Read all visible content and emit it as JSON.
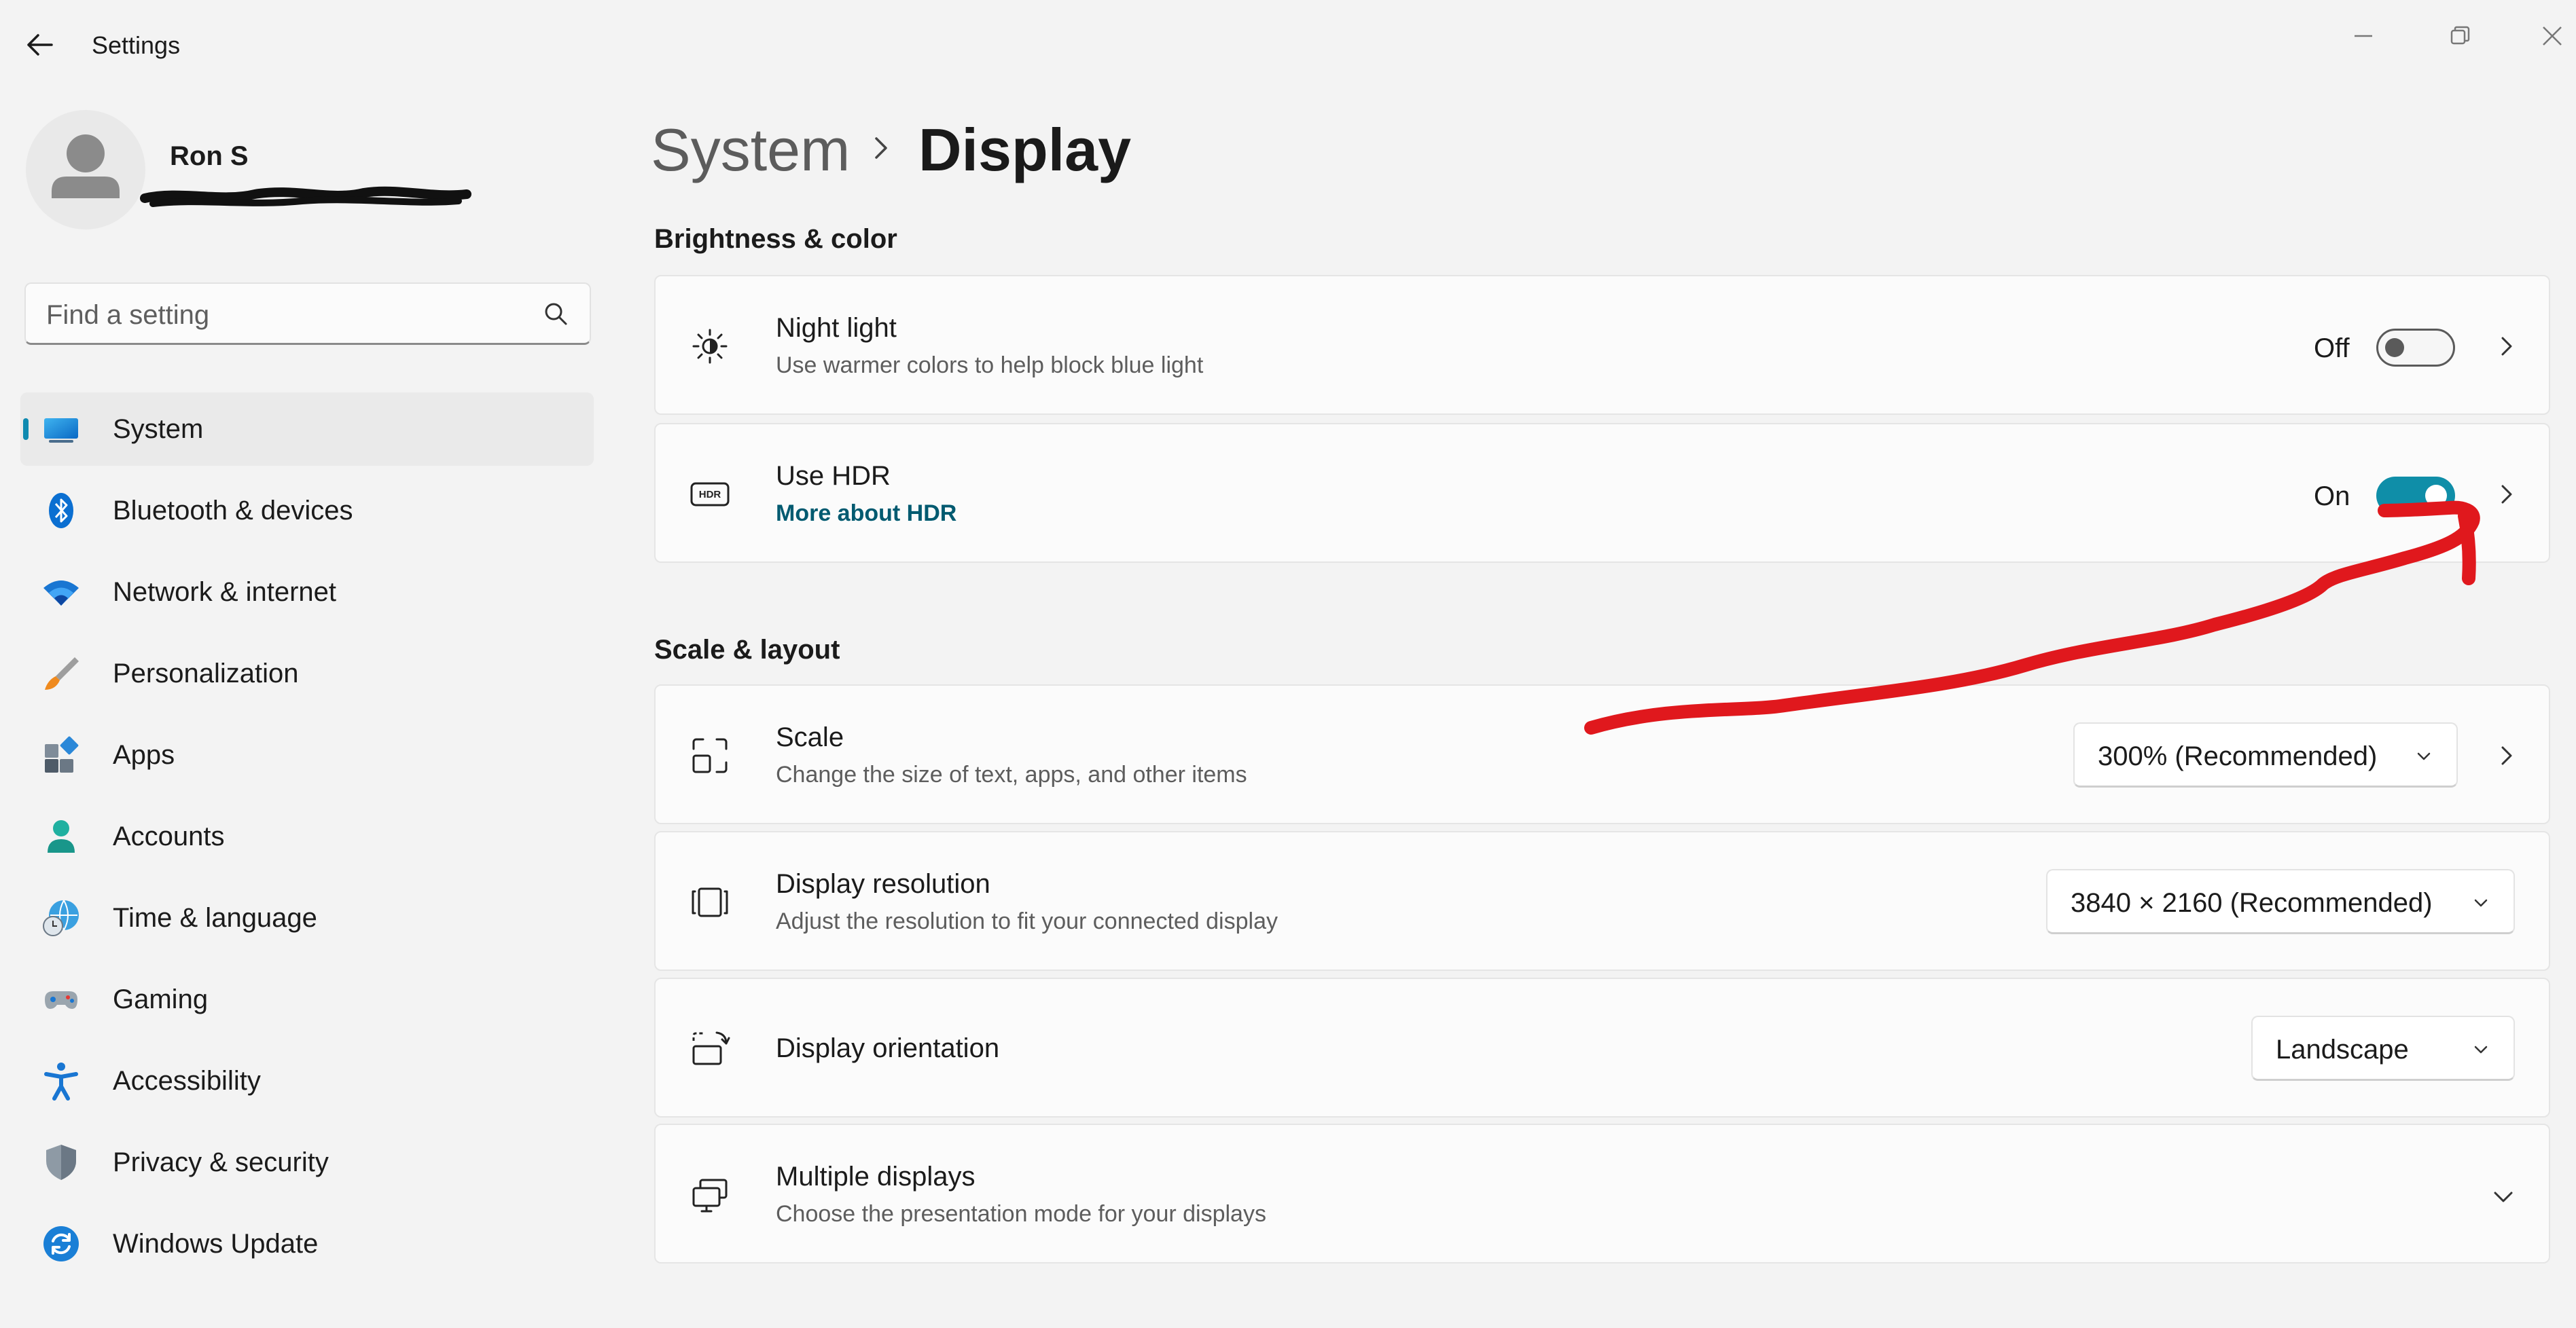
{
  "window": {
    "title": "Settings"
  },
  "profile": {
    "name": "Ron S"
  },
  "search": {
    "placeholder": "Find a setting"
  },
  "nav": {
    "items": [
      {
        "label": "System"
      },
      {
        "label": "Bluetooth & devices"
      },
      {
        "label": "Network & internet"
      },
      {
        "label": "Personalization"
      },
      {
        "label": "Apps"
      },
      {
        "label": "Accounts"
      },
      {
        "label": "Time & language"
      },
      {
        "label": "Gaming"
      },
      {
        "label": "Accessibility"
      },
      {
        "label": "Privacy & security"
      },
      {
        "label": "Windows Update"
      }
    ],
    "active_index": 0
  },
  "breadcrumb": {
    "parent": "System",
    "current": "Display"
  },
  "sections": {
    "brightness_title": "Brightness & color",
    "scale_title": "Scale & layout"
  },
  "night_light": {
    "title": "Night light",
    "subtitle": "Use warmer colors to help block blue light",
    "state_label": "Off",
    "on": false
  },
  "hdr": {
    "title": "Use HDR",
    "link": "More about HDR",
    "state_label": "On",
    "on": true
  },
  "scale": {
    "title": "Scale",
    "subtitle": "Change the size of text, apps, and other items",
    "value": "300% (Recommended)"
  },
  "resolution": {
    "title": "Display resolution",
    "subtitle": "Adjust the resolution to fit your connected display",
    "value": "3840 × 2160 (Recommended)"
  },
  "orientation": {
    "title": "Display orientation",
    "value": "Landscape"
  },
  "multiple_displays": {
    "title": "Multiple displays",
    "subtitle": "Choose the presentation mode for your displays"
  },
  "colors": {
    "accent": "#0f8ea8",
    "link": "#005a70",
    "annotation": "#e0181d",
    "background": "#f3f3f3"
  },
  "icons": {
    "back": "back-arrow-icon",
    "minimize": "minimize-icon",
    "restore": "restore-icon",
    "close": "close-icon",
    "search": "search-icon",
    "night_light": "night-light-icon",
    "hdr": "hdr-icon",
    "scale": "scale-icon",
    "resolution": "resolution-icon",
    "orientation": "orientation-icon",
    "multiple_displays": "multiple-displays-icon"
  }
}
